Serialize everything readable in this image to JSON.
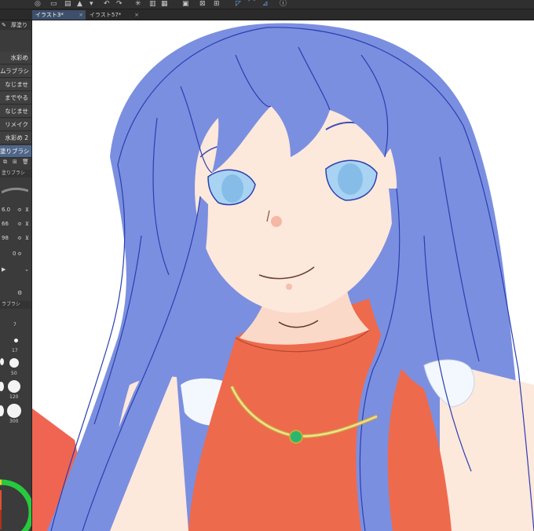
{
  "tabs": [
    {
      "label": "イラスト3*",
      "active": true
    },
    {
      "label": "イラスト57*",
      "active": false
    }
  ],
  "tool_panel": {
    "header": "厚塗り",
    "brushes": [
      {
        "label": "水彩め",
        "selected": false
      },
      {
        "label": "ムラブラシ",
        "selected": false
      },
      {
        "label": "なじませ",
        "selected": false
      },
      {
        "label": "までやる",
        "selected": false
      },
      {
        "label": "なじませ",
        "selected": false
      },
      {
        "label": "リメイク",
        "selected": false
      },
      {
        "label": "水彩め 2",
        "selected": false
      },
      {
        "label": "塗りブラシ",
        "selected": true
      }
    ],
    "sub_header": "塗りブラシ",
    "settings": [
      {
        "value": "6.0"
      },
      {
        "value": "66"
      },
      {
        "value": "98"
      },
      {
        "value": "0"
      }
    ],
    "size_header": "ラブラシ",
    "brush_sizes": [
      "7",
      "17",
      "50",
      "120",
      "300"
    ]
  },
  "colors": {
    "accent": "#4f6688",
    "hair": "#7b8fe0",
    "hair_line": "#2a3fb0",
    "skin": "#fde8dc",
    "top": "#ee6a4c",
    "eyes": "#a9d3f2",
    "necklace": "#e8d07a",
    "gem": "#27b86e"
  }
}
